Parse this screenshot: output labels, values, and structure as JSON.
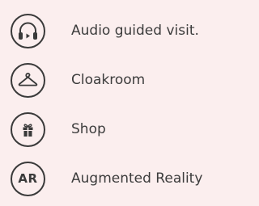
{
  "colors": {
    "background": "#fbeeee",
    "icon_stroke": "#3a3a3a",
    "text": "#3c3c3c"
  },
  "items": [
    {
      "icon": "headphones-icon",
      "label": "Audio guided visit."
    },
    {
      "icon": "hanger-icon",
      "label": "Cloakroom"
    },
    {
      "icon": "gift-icon",
      "label": "Shop"
    },
    {
      "icon": "ar-icon",
      "icon_text": "AR",
      "label": "Augmented Reality"
    }
  ]
}
